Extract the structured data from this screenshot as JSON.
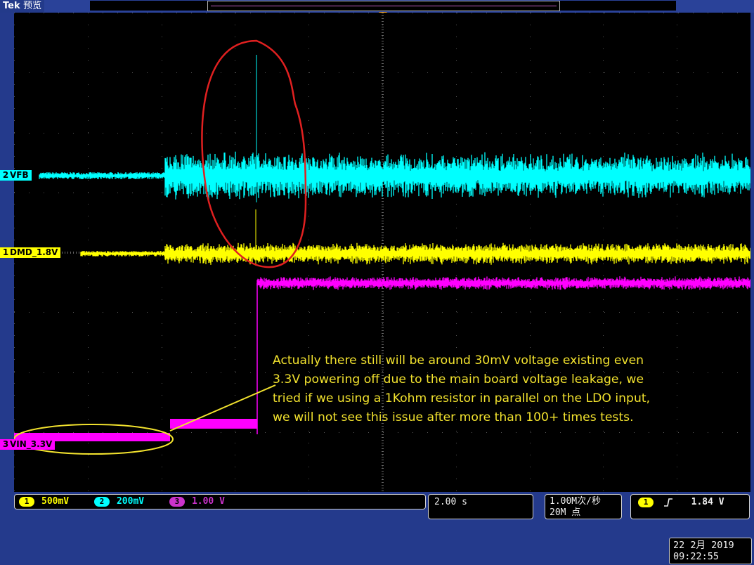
{
  "header": {
    "brand": "Tek",
    "mode": "预览"
  },
  "channels": [
    {
      "id": "2",
      "label": "VFB",
      "color": "#00ffff"
    },
    {
      "id": "1",
      "label": "DMD_1.8V",
      "color": "#ffff00"
    },
    {
      "id": "3",
      "label": "VIN_3.3V",
      "color": "#ff00ff"
    }
  ],
  "annotation": {
    "lines": [
      "Actually there still will be around 30mV voltage existing even",
      "3.3V powering off due to the main board voltage leakage, we",
      "tried if we using a 1Kohm resistor in parallel on the LDO input,",
      "we will not see this issue after more than 100+ times tests."
    ],
    "color": "#f2e22e"
  },
  "readouts": {
    "vertical": [
      {
        "channel": "1",
        "scale": "500mV",
        "color": "#ffff00"
      },
      {
        "channel": "2",
        "scale": "200mV",
        "color": "#00ffff"
      },
      {
        "channel": "3",
        "scale": "1.00 V",
        "color": "#cc33cc"
      }
    ],
    "timebase": "2.00 s",
    "sample_rate": "1.00M次/秒",
    "record_length": "20M 点",
    "trigger": {
      "channel": "1",
      "slope_icon": "rising-edge-icon",
      "level": "1.84 V"
    }
  },
  "datetime": {
    "date": "22 2月 2019",
    "time": "09:22:55"
  },
  "overlays": {
    "circle_color": "#e02020",
    "ellipse_color": "#f2e22e"
  }
}
